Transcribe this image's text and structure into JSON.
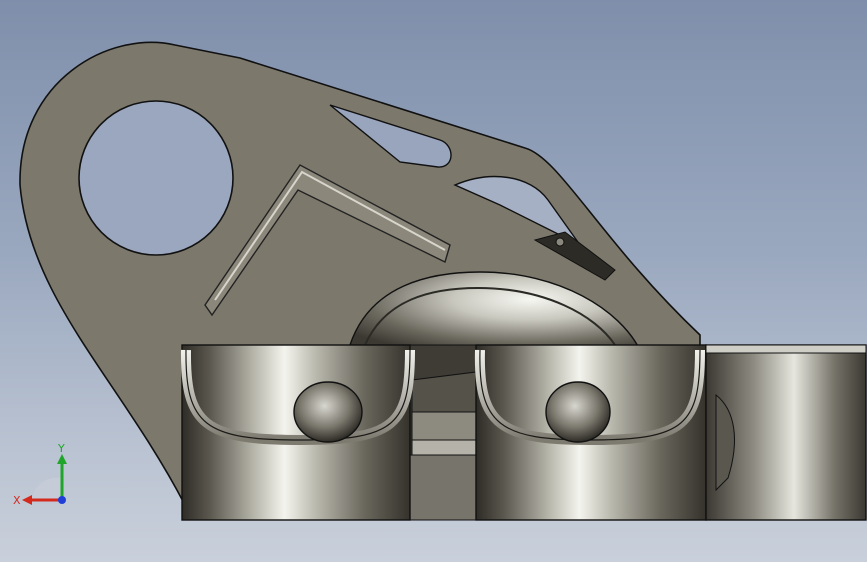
{
  "viewport": {
    "background_top": "#7f8fab",
    "background_bottom": "#c9d0db"
  },
  "model": {
    "plate_color": "#7c786c",
    "metal_dark": "#3f3d35",
    "metal_light": "#efefe8",
    "edge_color": "#111111"
  },
  "triad": {
    "x_label": "X",
    "y_label": "Y",
    "x_color": "#d42a1e",
    "y_color": "#1ea52a",
    "z_color": "#1f3fd8"
  }
}
